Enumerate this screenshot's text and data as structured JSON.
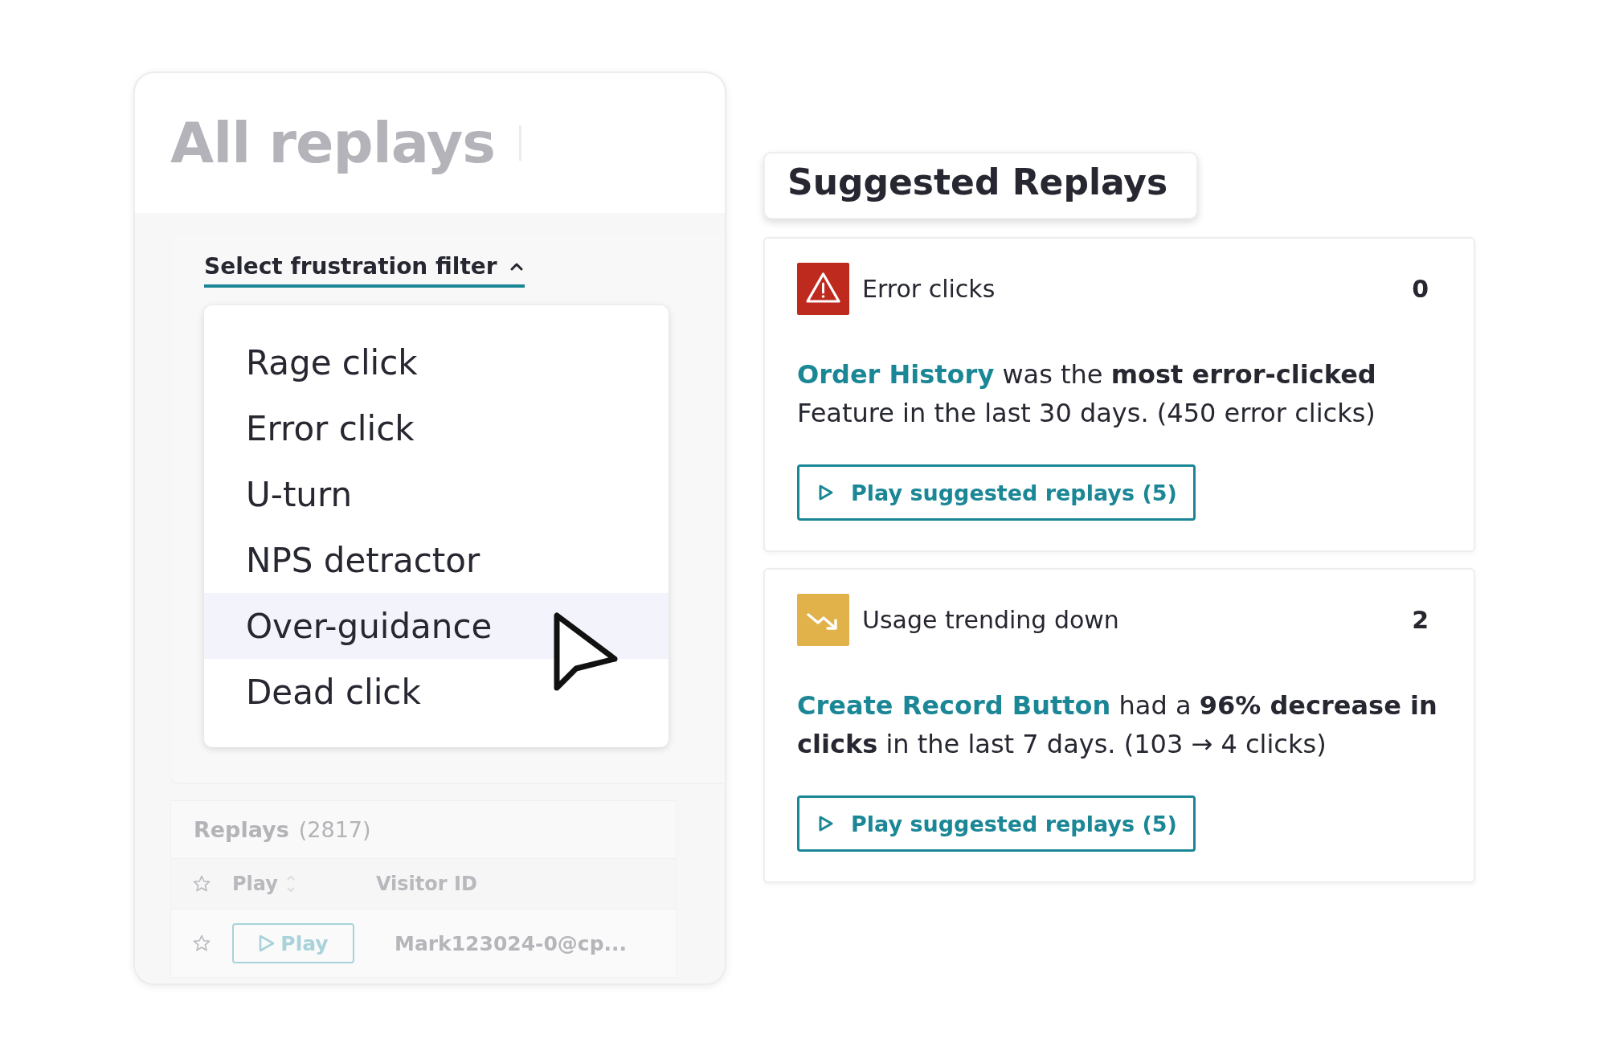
{
  "panel": {
    "title": "All replays",
    "filter": {
      "label": "Select frustration filter",
      "expanded": true,
      "options": [
        {
          "label": "Rage click",
          "selected": false
        },
        {
          "label": "Error click",
          "selected": false
        },
        {
          "label": "U-turn",
          "selected": false
        },
        {
          "label": "NPS detractor",
          "selected": false
        },
        {
          "label": "Over-guidance",
          "selected": true
        },
        {
          "label": "Dead click",
          "selected": false
        }
      ]
    },
    "replays": {
      "title": "Replays",
      "count": "(2817)",
      "columns": [
        "Play",
        "Visitor ID"
      ],
      "rows": [
        {
          "starred": false,
          "play": "Play",
          "visitor_id": "Mark123024-0@cp..."
        }
      ]
    }
  },
  "suggested": {
    "title": "Suggested Replays",
    "cards": [
      {
        "kind": "error",
        "title": "Error clicks",
        "count": "0",
        "link": "Order History",
        "text": " was the **most error-clicked** Feature in the last 30 days. (450 error clicks)",
        "button": "Play suggested replays (5)"
      },
      {
        "kind": "trend",
        "title": "Usage trending down",
        "count": "2",
        "link": "Create Record Button",
        "text": " had a **96% decrease in clicks** in the last 7 days. (103 → 4 clicks)",
        "button": "Play suggested replays (5)"
      }
    ]
  }
}
